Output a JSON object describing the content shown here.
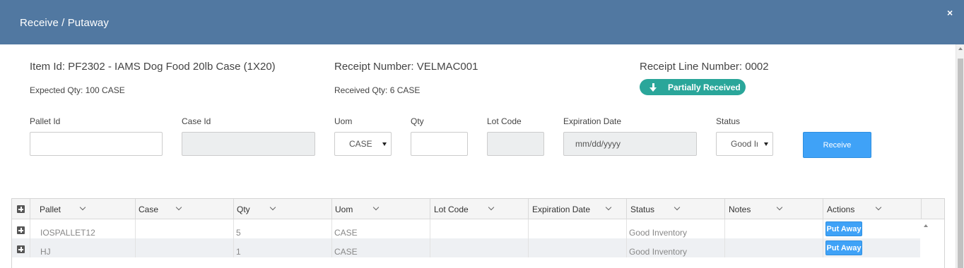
{
  "modal": {
    "title": "Receive / Putaway",
    "close_glyph": "×"
  },
  "item": {
    "item_label": "Item Id: PF2302 - IAMS Dog Food 20lb Case (1X20)",
    "expected_qty": "Expected Qty: 100 CASE",
    "receipt_number": "Receipt Number: VELMAC001",
    "received_qty": "Received Qty: 6 CASE",
    "receipt_line": "Receipt Line Number: 0002",
    "status_badge": "Partially Received"
  },
  "form": {
    "pallet_id": {
      "label": "Pallet Id",
      "value": ""
    },
    "case_id": {
      "label": "Case Id",
      "value": ""
    },
    "uom": {
      "label": "Uom",
      "value": "CASE"
    },
    "qty": {
      "label": "Qty",
      "value": ""
    },
    "lot_code": {
      "label": "Lot Code",
      "value": ""
    },
    "expiration_date": {
      "label": "Expiration Date",
      "placeholder": "mm/dd/yyyy"
    },
    "status": {
      "label": "Status",
      "value": "Good Inventory"
    },
    "receive_button": "Receive"
  },
  "grid": {
    "columns": [
      "Pallet",
      "Case",
      "Qty",
      "Uom",
      "Lot Code",
      "Expiration Date",
      "Status",
      "Notes",
      "Actions"
    ],
    "rows": [
      {
        "pallet": "IOSPALLET12",
        "case": "",
        "qty": "5",
        "uom": "CASE",
        "lot_code": "",
        "expiration_date": "",
        "status": "Good Inventory",
        "notes": "",
        "action": "Put Away"
      },
      {
        "pallet": "HJ",
        "case": "",
        "qty": "1",
        "uom": "CASE",
        "lot_code": "",
        "expiration_date": "",
        "status": "Good Inventory",
        "notes": "",
        "action": "Put Away"
      }
    ]
  },
  "colors": {
    "header_bg": "#5178a1",
    "badge_bg": "#2aa69a",
    "button_bg": "#3fa2f7"
  },
  "icons": {
    "close": "close-icon",
    "badge": "arrow-down-icon",
    "expand": "plus-square-icon",
    "sort": "chevron-down-icon"
  }
}
